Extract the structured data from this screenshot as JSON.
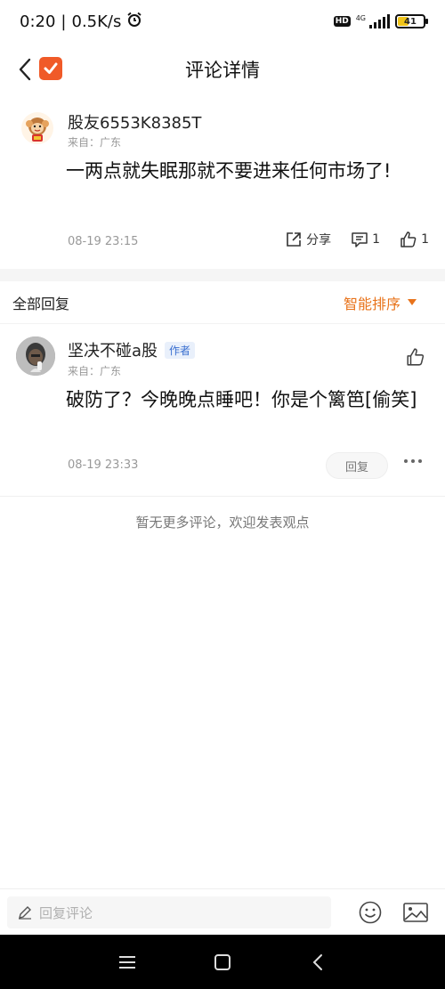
{
  "status_bar": {
    "time": "0:20",
    "net_speed": "0.5K/s",
    "hd": "HD",
    "network": "4G",
    "battery": "41",
    "battery_level": 0.41
  },
  "header": {
    "title": "评论详情"
  },
  "main_comment": {
    "user": "股友6553K8385T",
    "location": "来自：广东",
    "text": "一两点就失眠那就不要进来任何市场了!",
    "time": "08-19 23:15",
    "share_label": "分享",
    "comment_count": "1",
    "like_count": "1"
  },
  "replies": {
    "all_label": "全部回复",
    "sort_label": "智能排序",
    "items": [
      {
        "user": "坚决不碰a股",
        "badge": "作者",
        "location": "来自：广东",
        "text": "破防了？今晚晚点睡吧！你是个篱笆[偷笑]",
        "time": "08-19 23:33",
        "reply_label": "回复"
      }
    ]
  },
  "no_more": "暂无更多评论，欢迎发表观点",
  "input_bar": {
    "placeholder": "回复评论"
  },
  "colors": {
    "accent": "#e8731b",
    "logo": "#f05a28",
    "badge_text": "#3a6fd0"
  }
}
